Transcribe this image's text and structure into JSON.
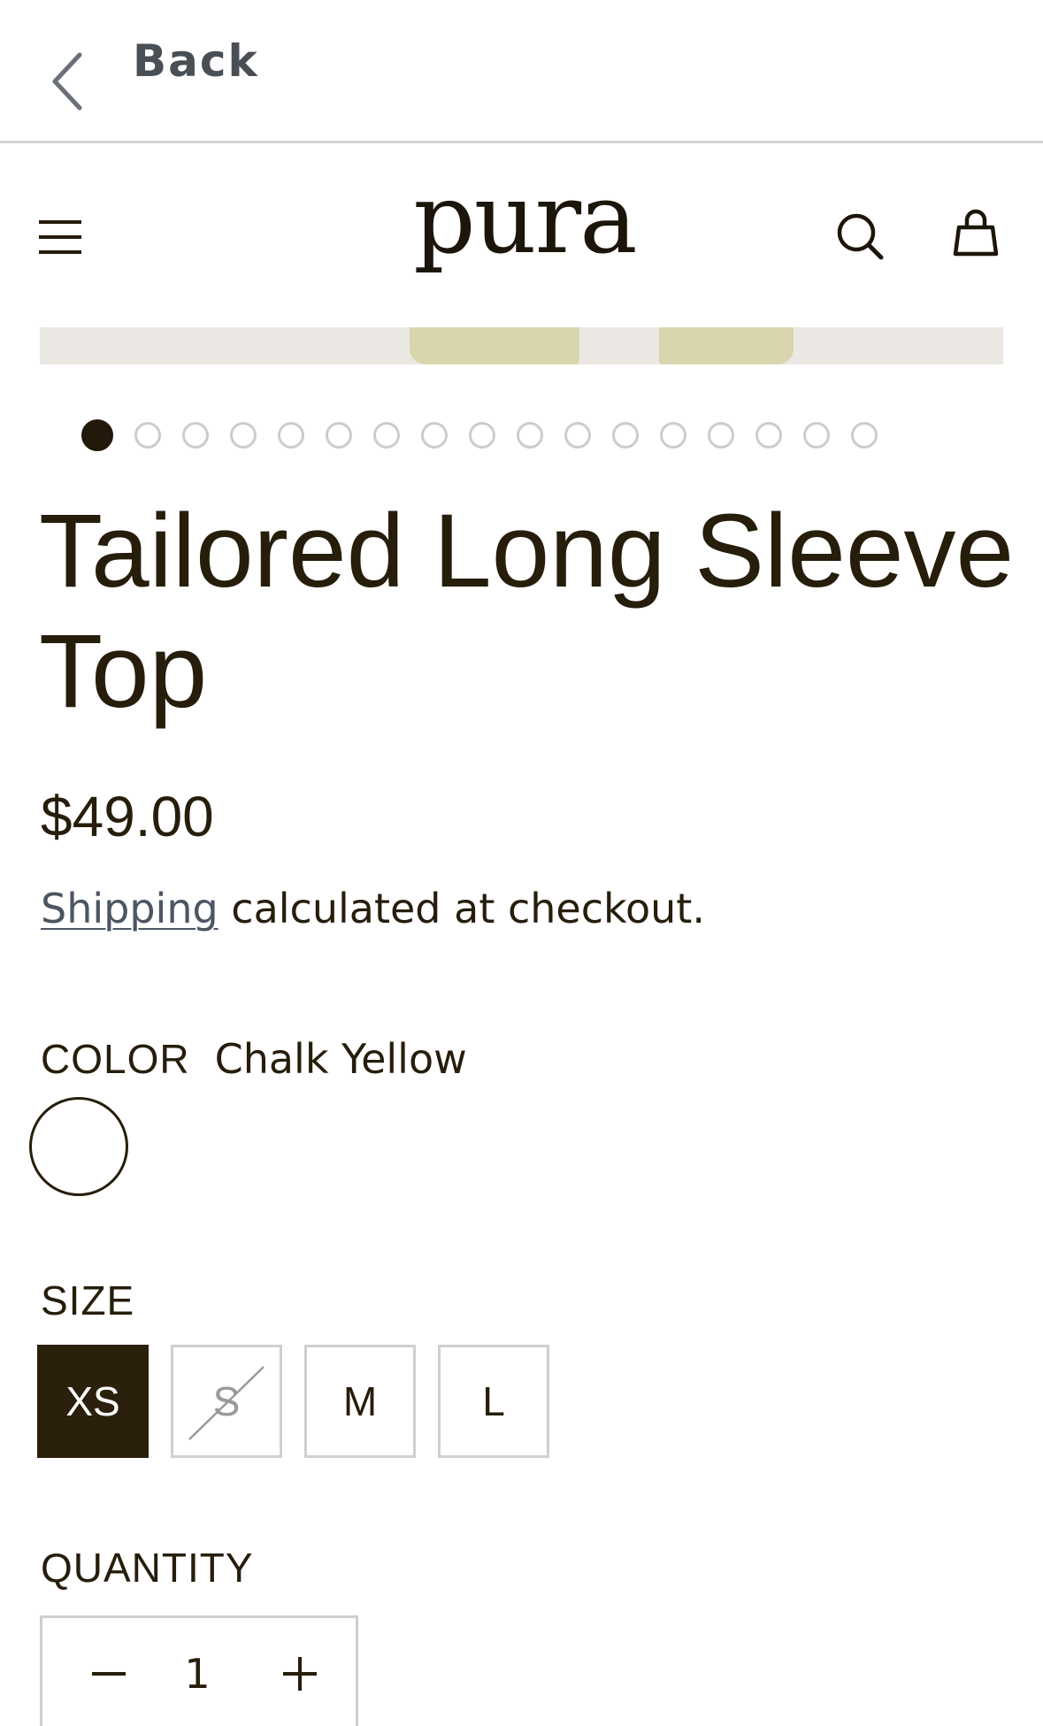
{
  "nav": {
    "back_label": "Back"
  },
  "header": {
    "logo_text": "pura",
    "icons": [
      "menu-icon",
      "search-icon",
      "cart-icon"
    ]
  },
  "carousel": {
    "total_slides": 17,
    "active_index": 0
  },
  "product": {
    "title": "Tailored Long Sleeve Top",
    "price": "$49.00",
    "shipping_link": "Shipping",
    "shipping_text": " calculated at checkout."
  },
  "color": {
    "label": "COLOR",
    "selected": "Chalk Yellow",
    "swatch_hex": "#ffffff"
  },
  "size": {
    "label": "SIZE",
    "options": [
      {
        "label": "XS",
        "selected": true,
        "available": true
      },
      {
        "label": "S",
        "selected": false,
        "available": false
      },
      {
        "label": "M",
        "selected": false,
        "available": true
      },
      {
        "label": "L",
        "selected": false,
        "available": true
      }
    ]
  },
  "quantity": {
    "label": "QUANTITY",
    "value": "1"
  },
  "colors": {
    "text": "#261d0b",
    "selected_bg": "#2b200c",
    "border": "#cfcfcf",
    "link": "#4b5563",
    "garment": "#d9d6ad"
  }
}
